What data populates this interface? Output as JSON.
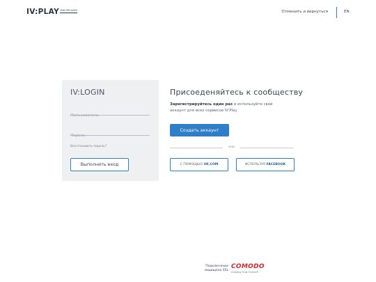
{
  "header": {
    "logo_main": "IV:PLAY",
    "logo_sub": "MULTIPLAYER",
    "cancel_link": "Отменить и вернуться",
    "lang": "EN",
    "divider_color": "#2f7ec9"
  },
  "login": {
    "title": "IV:LOGIN",
    "username_placeholder": "Пользователь",
    "password_placeholder": "Пароль",
    "restore_link": "Восстановить пароль?",
    "submit_label": "Выполнить вход"
  },
  "join": {
    "title": "Присоеденяйтесь к сообществу",
    "desc_bold": "Зарегистрируйтесь один раз",
    "desc_rest": " и используйте свой аккаунт для всех сервисов IV:Play",
    "create_button": "Создать аккаунт",
    "or": "или",
    "vk_prefix": "С ПОМОЩЬЮ",
    "vk_brand": "VK.COM",
    "fb_prefix": "ИСПОЛЬЗУЯ",
    "fb_brand": "FACEBOOK"
  },
  "footer": {
    "ssl_line1": "Подключение",
    "ssl_line2": "защищено SSL",
    "comodo_name": "COMODO",
    "comodo_tagline": "Creating Trust Online®"
  },
  "colors": {
    "accent": "#2f7ec9",
    "card_bg": "#eef0f2",
    "comodo_red": "#d8262f"
  }
}
